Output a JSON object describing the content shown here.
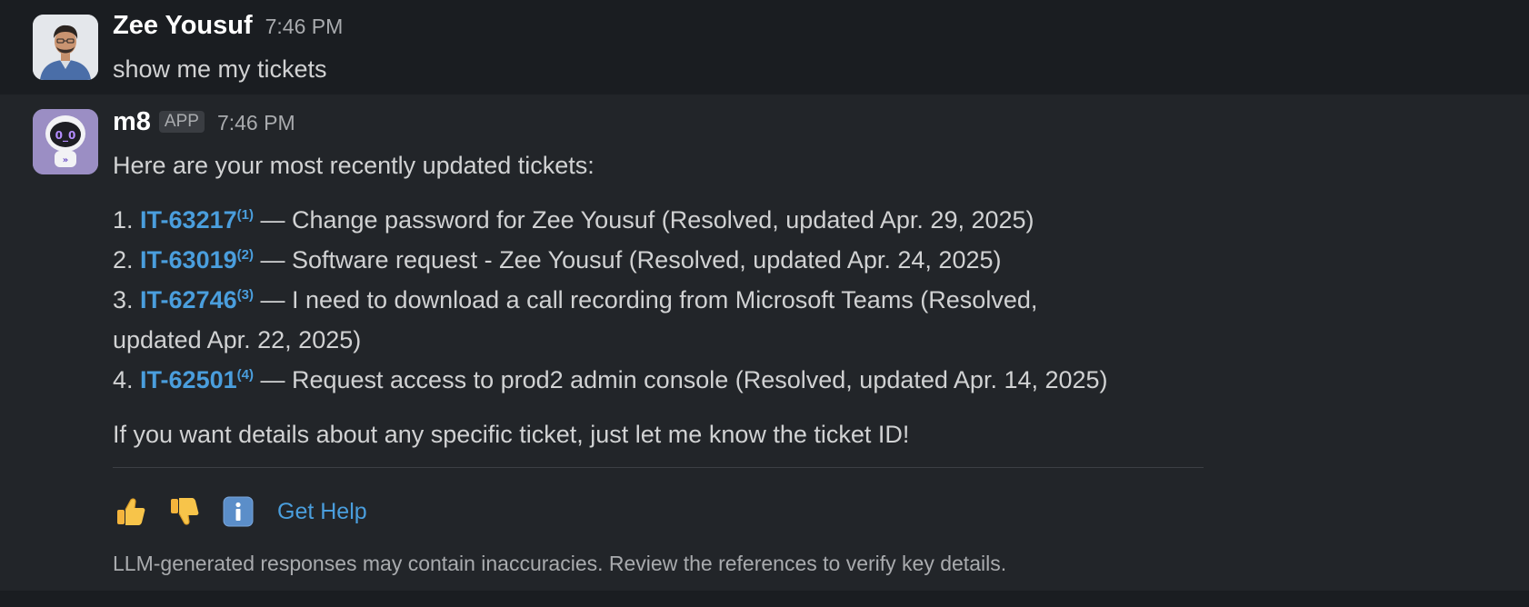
{
  "messages": {
    "user": {
      "name": "Zee Yousuf",
      "time": "7:46 PM",
      "text": "show me my tickets"
    },
    "bot": {
      "name": "m8",
      "badge": "APP",
      "time": "7:46 PM",
      "intro": "Here are your most recently updated tickets:",
      "tickets": [
        {
          "num": "1.",
          "id": "IT-63217",
          "ref": "(1)",
          "desc": " — Change password for Zee Yousuf (Resolved, updated Apr. 29, 2025)"
        },
        {
          "num": "2.",
          "id": "IT-63019",
          "ref": "(2)",
          "desc": " — Software request - Zee Yousuf (Resolved, updated Apr. 24, 2025)"
        },
        {
          "num": "3.",
          "id": "IT-62746",
          "ref": "(3)",
          "desc": " — I need to download a call recording from Microsoft Teams (Resolved, updated Apr. 22, 2025)"
        },
        {
          "num": "4.",
          "id": "IT-62501",
          "ref": "(4)",
          "desc": " — Request access to prod2 admin console (Resolved, updated Apr. 14, 2025)"
        }
      ],
      "outro": "If you want details about any specific ticket, just let me know the ticket ID!",
      "actions": {
        "thumbs_up_icon": "thumbs-up-icon",
        "thumbs_down_icon": "thumbs-down-icon",
        "info_icon": "info-icon",
        "get_help": "Get Help"
      },
      "disclaimer": "LLM-generated responses may contain inaccuracies. Review the references to verify key details."
    }
  },
  "colors": {
    "background": "#1a1d21",
    "bot_background": "#222529",
    "link": "#4a9edd",
    "text": "#d1d2d3",
    "muted": "#a9abae"
  }
}
